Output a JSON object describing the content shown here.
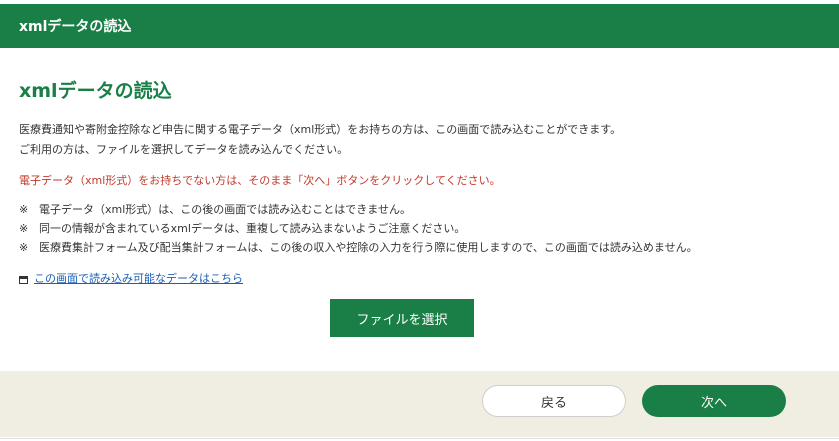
{
  "header": {
    "title": "xmlデータの読込"
  },
  "main": {
    "page_title": "xmlデータの読込",
    "intro_line1": "医療費通知や寄附金控除など申告に関する電子データ（xml形式）をお持ちの方は、この画面で読み込むことができます。",
    "intro_line2": "ご利用の方は、ファイルを選択してデータを読み込んでください。",
    "warning": "電子データ（xml形式）をお持ちでない方は、そのまま「次へ」ボタンをクリックしてください。",
    "notes": [
      {
        "mark": "※",
        "text": "電子データ（xml形式）は、この後の画面では読み込むことはできません。"
      },
      {
        "mark": "※",
        "text": "同一の情報が含まれているxmlデータは、重複して読み込まないようご注意ください。"
      },
      {
        "mark": "※",
        "text": "医療費集計フォーム及び配当集計フォームは、この後の収入や控除の入力を行う際に使用しますので、この画面では読み込めません。"
      }
    ],
    "link_text": "この画面で読み込み可能なデータはこちら",
    "file_button_label": "ファイルを選択"
  },
  "footer": {
    "back_label": "戻る",
    "next_label": "次へ"
  },
  "colors": {
    "brand_green": "#1a7f46",
    "warning_red": "#c0392b",
    "link_blue": "#1a5fb4",
    "footer_bg": "#f0ede3"
  },
  "icons": {
    "link_icon": "window-icon"
  }
}
